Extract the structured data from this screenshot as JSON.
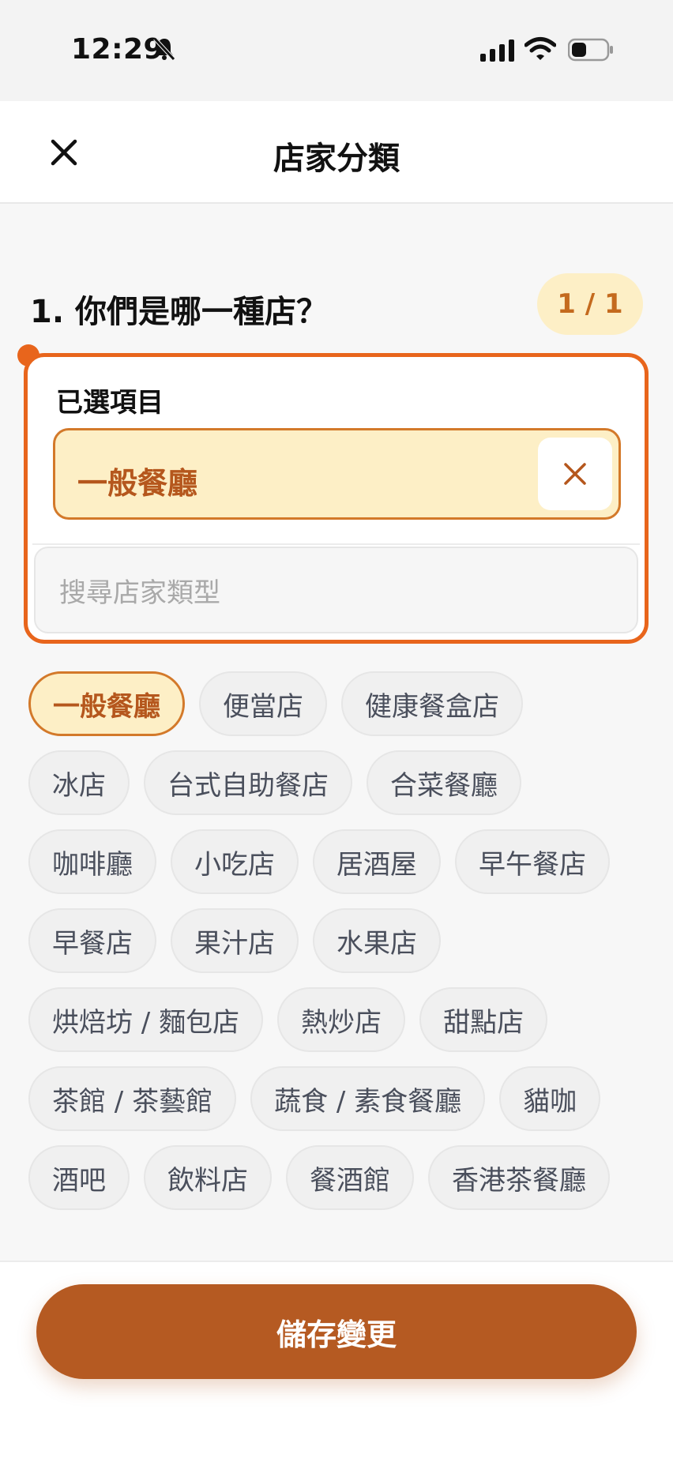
{
  "status_bar": {
    "time": "12:29"
  },
  "header": {
    "title": "店家分類"
  },
  "question": {
    "text": "1. 你們是哪一種店？",
    "counter": "1 / 1"
  },
  "selected": {
    "label": "已選項目",
    "items": [
      "一般餐廳"
    ]
  },
  "search": {
    "placeholder": "搜尋店家類型"
  },
  "categories": [
    [
      "一般餐廳",
      "便當店",
      "健康餐盒店"
    ],
    [
      "冰店",
      "台式自助餐店",
      "合菜餐廳"
    ],
    [
      "咖啡廳",
      "小吃店",
      "居酒屋",
      "早午餐店"
    ],
    [
      "早餐店",
      "果汁店",
      "水果店"
    ],
    [
      "烘焙坊 / 麵包店",
      "熱炒店",
      "甜點店"
    ],
    [
      "茶館 / 茶藝館",
      "蔬食 / 素食餐廳",
      "貓咖"
    ],
    [
      "酒吧",
      "飲料店",
      "餐酒館",
      "香港茶餐廳"
    ]
  ],
  "active_category": "一般餐廳",
  "footer": {
    "save_label": "儲存變更"
  },
  "colors": {
    "accent": "#e8651c",
    "brand": "#b55a22",
    "chip_active_bg": "#fdefc6"
  }
}
